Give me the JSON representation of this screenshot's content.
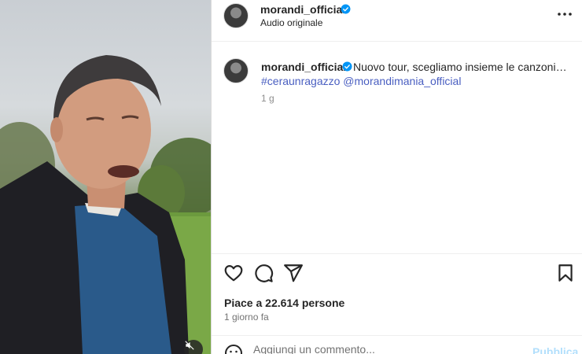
{
  "header": {
    "username": "morandi_official",
    "audio_label": "Audio originale"
  },
  "caption": {
    "username": "morandi_official",
    "text": "Nuovo tour, scegliamo insieme le canzoni…",
    "hashtag": "#ceraunragazzo",
    "mention": "@morandimania_official",
    "time": "1 g"
  },
  "stats": {
    "likes": "Piace a 22.614 persone",
    "posted": "1 giorno fa"
  },
  "comment": {
    "placeholder": "Aggiungi un commento...",
    "publish_label": "Pubblica"
  },
  "icons": {
    "verified": "verified-badge-icon",
    "more": "more-options-icon",
    "like": "heart-icon",
    "comment": "comment-icon",
    "share": "send-icon",
    "save": "bookmark-icon",
    "emoji": "emoji-icon",
    "mute": "muted-speaker-icon"
  },
  "colors": {
    "verified": "#0095f6",
    "link": "#00376b",
    "publish_disabled": "#b2dffc"
  }
}
